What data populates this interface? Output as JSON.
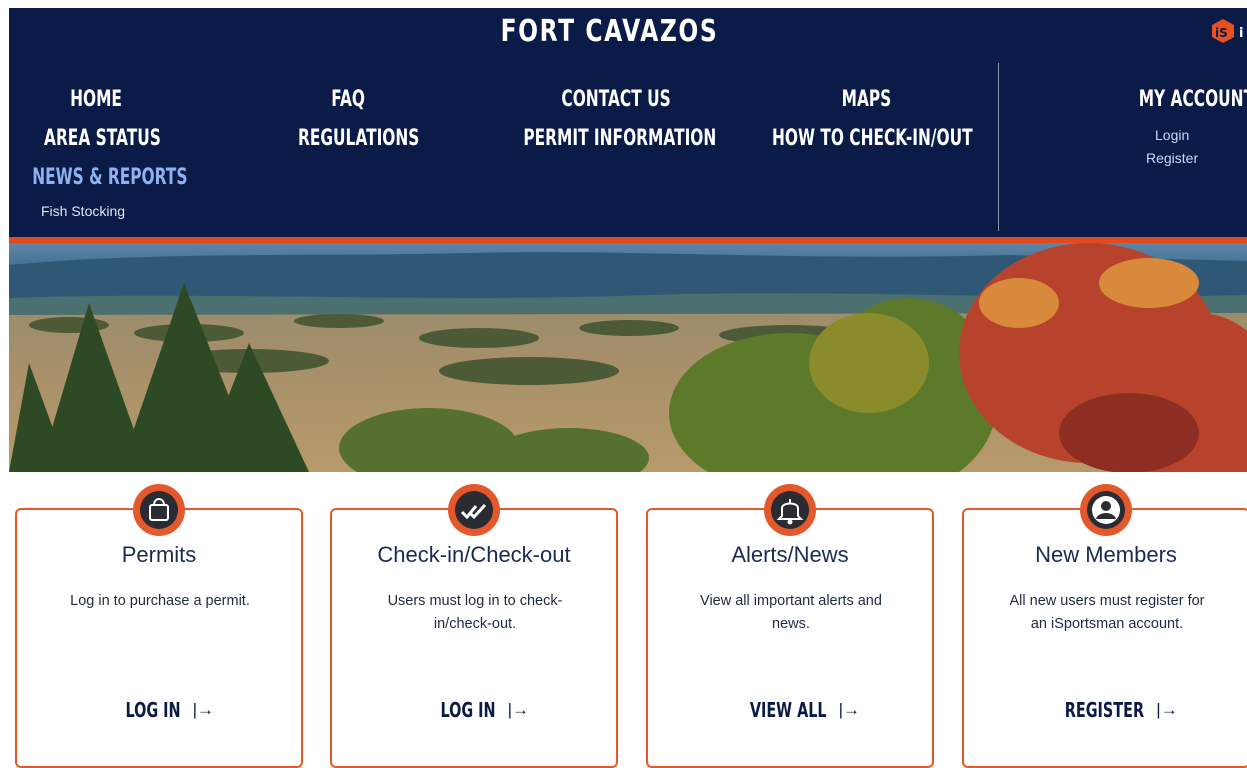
{
  "header": {
    "site_title": "FORT CAVAZOS",
    "brand_icon": "isportsman-logo-icon",
    "nav": {
      "home": "HOME",
      "faq": "FAQ",
      "contact_us": "CONTACT US",
      "maps": "MAPS",
      "area_status": "AREA STATUS",
      "regulations": "REGULATIONS",
      "permit_information": "PERMIT INFORMATION",
      "how_to_check": "HOW TO CHECK-IN/OUT",
      "news_reports": "NEWS & REPORTS",
      "news_sub_item": "Fish Stocking"
    },
    "account": {
      "title": "MY ACCOUNT",
      "login": "Login",
      "register": "Register"
    }
  },
  "colors": {
    "header_bg": "#0b1b48",
    "accent": "#e04a1e",
    "active_nav": "#8fb2ef"
  },
  "cards": [
    {
      "icon": "shopping-bag-icon",
      "title": "Permits",
      "text": "Log in to purchase a permit.",
      "action": "LOG IN",
      "arrow": "|→"
    },
    {
      "icon": "double-check-icon",
      "title": "Check-in/Check-out",
      "text": "Users must log in to check-in/check-out.",
      "action": "LOG IN",
      "arrow": "|→"
    },
    {
      "icon": "bell-icon",
      "title": "Alerts/News",
      "text": "View all important alerts and news.",
      "action": "VIEW ALL",
      "arrow": "|→"
    },
    {
      "icon": "user-icon",
      "title": "New Members",
      "text": "All new users must register for an iSportsman account.",
      "action": "REGISTER",
      "arrow": "|→"
    }
  ]
}
